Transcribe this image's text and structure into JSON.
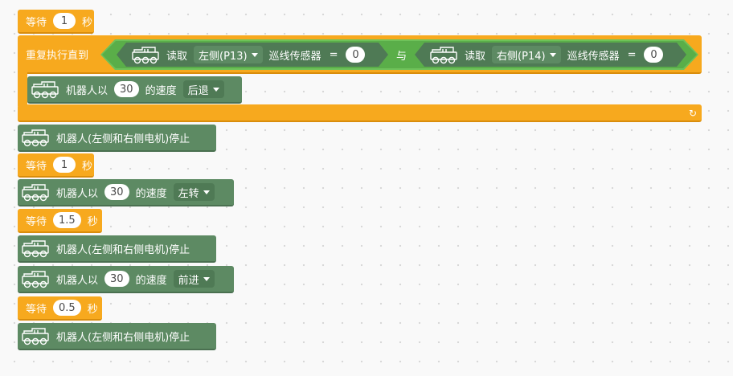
{
  "blocks": {
    "wait1": {
      "label": "等待",
      "value": "1",
      "unit": "秒"
    },
    "repeat": {
      "label": "重复执行直到",
      "and": "与",
      "left": {
        "read": "读取",
        "side": "左侧(P13)",
        "sensor": "巡线传感器",
        "eq": "=",
        "value": "0"
      },
      "right": {
        "read": "读取",
        "side": "右侧(P14)",
        "sensor": "巡线传感器",
        "eq": "=",
        "value": "0"
      },
      "loop_icon": "↻"
    },
    "move_back": {
      "prefix": "机器人以",
      "speed": "30",
      "mid": "的速度",
      "dir": "后退"
    },
    "stop1": {
      "label": "机器人(左侧和右侧电机)停止"
    },
    "wait2": {
      "label": "等待",
      "value": "1",
      "unit": "秒"
    },
    "move_left": {
      "prefix": "机器人以",
      "speed": "30",
      "mid": "的速度",
      "dir": "左转"
    },
    "wait3": {
      "label": "等待",
      "value": "1.5",
      "unit": "秒"
    },
    "stop2": {
      "label": "机器人(左侧和右侧电机)停止"
    },
    "move_fwd": {
      "prefix": "机器人以",
      "speed": "30",
      "mid": "的速度",
      "dir": "前进"
    },
    "wait4": {
      "label": "等待",
      "value": "0.5",
      "unit": "秒"
    },
    "stop3": {
      "label": "机器人(左侧和右侧电机)停止"
    }
  },
  "colors": {
    "control": "#f7a91e",
    "robot": "#5d8a63",
    "boolean": "#5aae49"
  },
  "icons": {
    "robot": "robot-car-icon",
    "dropdown": "chevron-down-icon",
    "loop": "loop-arrow-icon"
  }
}
